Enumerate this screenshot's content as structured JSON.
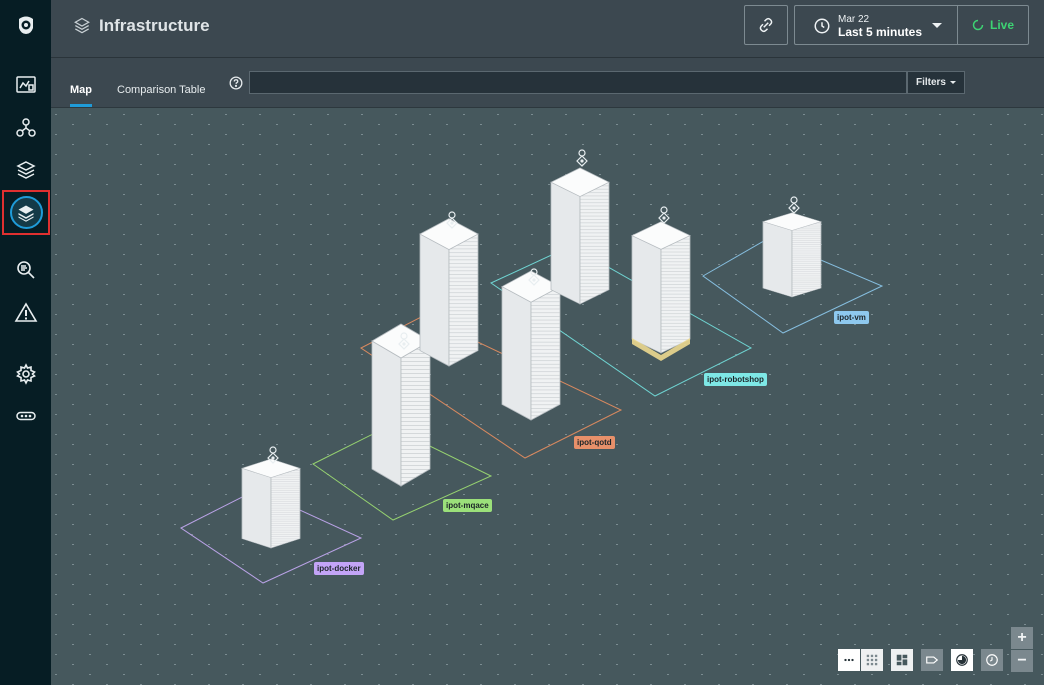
{
  "header": {
    "title": "Infrastructure",
    "time_date": "Mar 22",
    "time_range": "Last 5 minutes",
    "live_label": "Live"
  },
  "tabs": [
    {
      "label": "Map",
      "active": true
    },
    {
      "label": "Comparison Table",
      "active": false
    }
  ],
  "search": {
    "value": "",
    "placeholder": ""
  },
  "filters_label": "Filters",
  "sidebar": {
    "items": [
      {
        "icon": "logo-icon"
      },
      {
        "icon": "dashboard-icon"
      },
      {
        "icon": "application-perspectives-icon"
      },
      {
        "icon": "platforms-icon"
      },
      {
        "icon": "infrastructure-icon",
        "active": true
      },
      {
        "icon": "analytics-icon"
      },
      {
        "icon": "events-icon"
      },
      {
        "icon": "settings-icon"
      },
      {
        "icon": "more-icon"
      }
    ]
  },
  "map": {
    "zones": [
      {
        "label": "ipot-docker",
        "color": "#c3a4f7"
      },
      {
        "label": "ipot-mqace",
        "color": "#9be07a"
      },
      {
        "label": "ipot-qotd",
        "color": "#e8906a"
      },
      {
        "label": "ipot-robotshop",
        "color": "#7ee8e6"
      },
      {
        "label": "ipot-vm",
        "color": "#8ec8ee"
      }
    ]
  },
  "colors": {
    "accent": "#1f9bd8",
    "live": "#3dd273",
    "sidebar_bg": "#061d24",
    "map_bg": "#46585d"
  },
  "controls": {
    "zoom_in": "+",
    "zoom_out": "−",
    "icons": [
      "more-options-icon",
      "grid-icon",
      "layout-icon",
      "tag-icon",
      "color-by-icon",
      "clock-icon"
    ]
  }
}
